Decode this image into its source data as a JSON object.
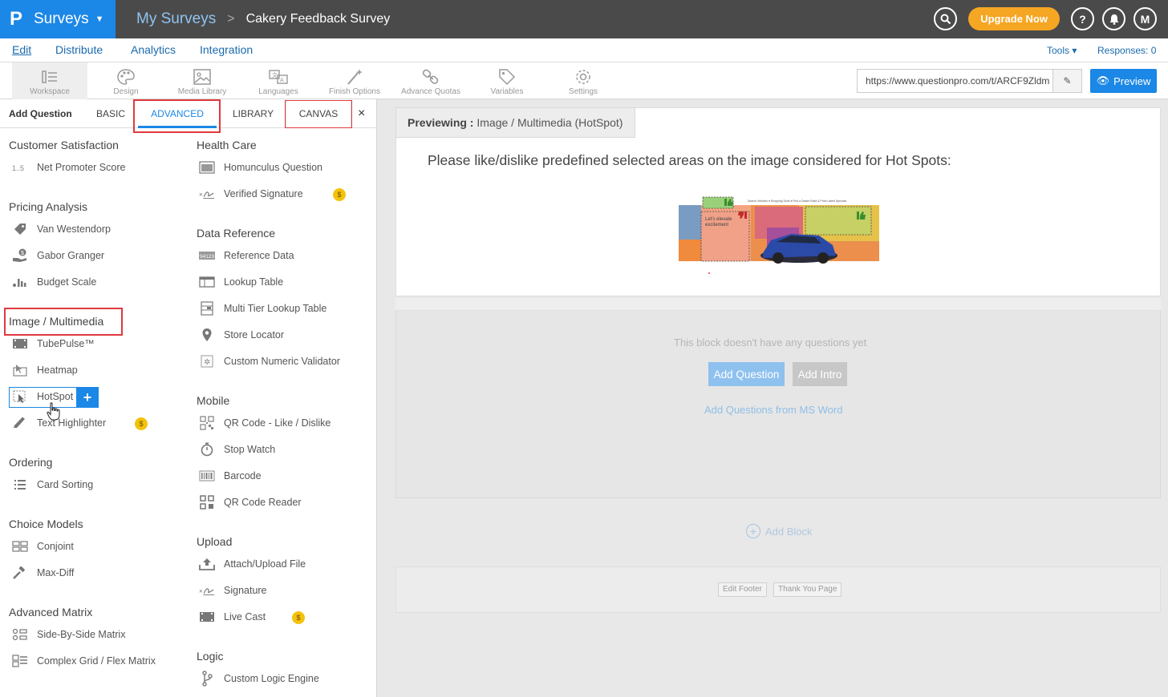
{
  "header": {
    "logo": "P",
    "app_name": "Surveys",
    "breadcrumb_parent": "My Surveys",
    "breadcrumb_sep": ">",
    "survey_title": "Cakery Feedback Survey",
    "upgrade_label": "Upgrade Now",
    "avatar_initial": "M"
  },
  "nav": {
    "edit": "Edit",
    "distribute": "Distribute",
    "analytics": "Analytics",
    "integration": "Integration",
    "tools": "Tools ▾",
    "responses": "Responses: 0"
  },
  "toolbar": {
    "workspace": "Workspace",
    "design": "Design",
    "media_library": "Media Library",
    "languages": "Languages",
    "finish_options": "Finish Options",
    "advance_quotas": "Advance Quotas",
    "variables": "Variables",
    "settings": "Settings",
    "url": "https://www.questionpro.com/t/ARCF9Zldm",
    "preview_label": "Preview"
  },
  "panel_tabs": {
    "add_question": "Add Question",
    "basic": "BASIC",
    "advanced": "ADVANCED",
    "library": "LIBRARY",
    "canvas": "CANVAS",
    "close": "×"
  },
  "left_column": {
    "customer_satisfaction": {
      "title": "Customer Satisfaction",
      "items": [
        "Net Promoter Score"
      ]
    },
    "pricing_analysis": {
      "title": "Pricing Analysis",
      "items": [
        "Van Westendorp",
        "Gabor Granger",
        "Budget Scale"
      ]
    },
    "image_multimedia": {
      "title": "Image / Multimedia",
      "items": [
        "TubePulse™",
        "Heatmap",
        "HotSpot",
        "Text Highlighter"
      ]
    },
    "ordering": {
      "title": "Ordering",
      "items": [
        "Card Sorting"
      ]
    },
    "choice_models": {
      "title": "Choice Models",
      "items": [
        "Conjoint",
        "Max-Diff"
      ]
    },
    "advanced_matrix": {
      "title": "Advanced Matrix",
      "items": [
        "Side-By-Side Matrix",
        "Complex Grid / Flex Matrix"
      ]
    }
  },
  "right_column": {
    "health_care": {
      "title": "Health Care",
      "items": [
        "Homunculus Question",
        "Verified Signature"
      ]
    },
    "data_reference": {
      "title": "Data Reference",
      "items": [
        "Reference Data",
        "Lookup Table",
        "Multi Tier Lookup Table",
        "Store Locator",
        "Custom Numeric Validator"
      ]
    },
    "mobile": {
      "title": "Mobile",
      "items": [
        "QR Code - Like / Dislike",
        "Stop Watch",
        "Barcode",
        "QR Code Reader"
      ]
    },
    "upload": {
      "title": "Upload",
      "items": [
        "Attach/Upload File",
        "Signature",
        "Live Cast"
      ]
    },
    "logic": {
      "title": "Logic",
      "items": [
        "Custom Logic Engine"
      ]
    }
  },
  "preview": {
    "label": "Previewing :",
    "value": "Image / Multimedia (HotSpot)",
    "question": "Please like/dislike predefined selected areas on the image considered for Hot Spots:"
  },
  "block": {
    "empty": "This block doesn't have any questions yet",
    "add_question": "Add Question",
    "add_intro": "Add Intro",
    "ms_word": "Add Questions from MS Word"
  },
  "add_block": "Add Block",
  "footer": {
    "edit_footer": "Edit Footer",
    "thank_you": "Thank You Page"
  },
  "colors": {
    "brand": "#1b87e6",
    "topbar": "#4a4a4a",
    "upgrade": "#f5a623",
    "highlight": "#e0393e"
  }
}
